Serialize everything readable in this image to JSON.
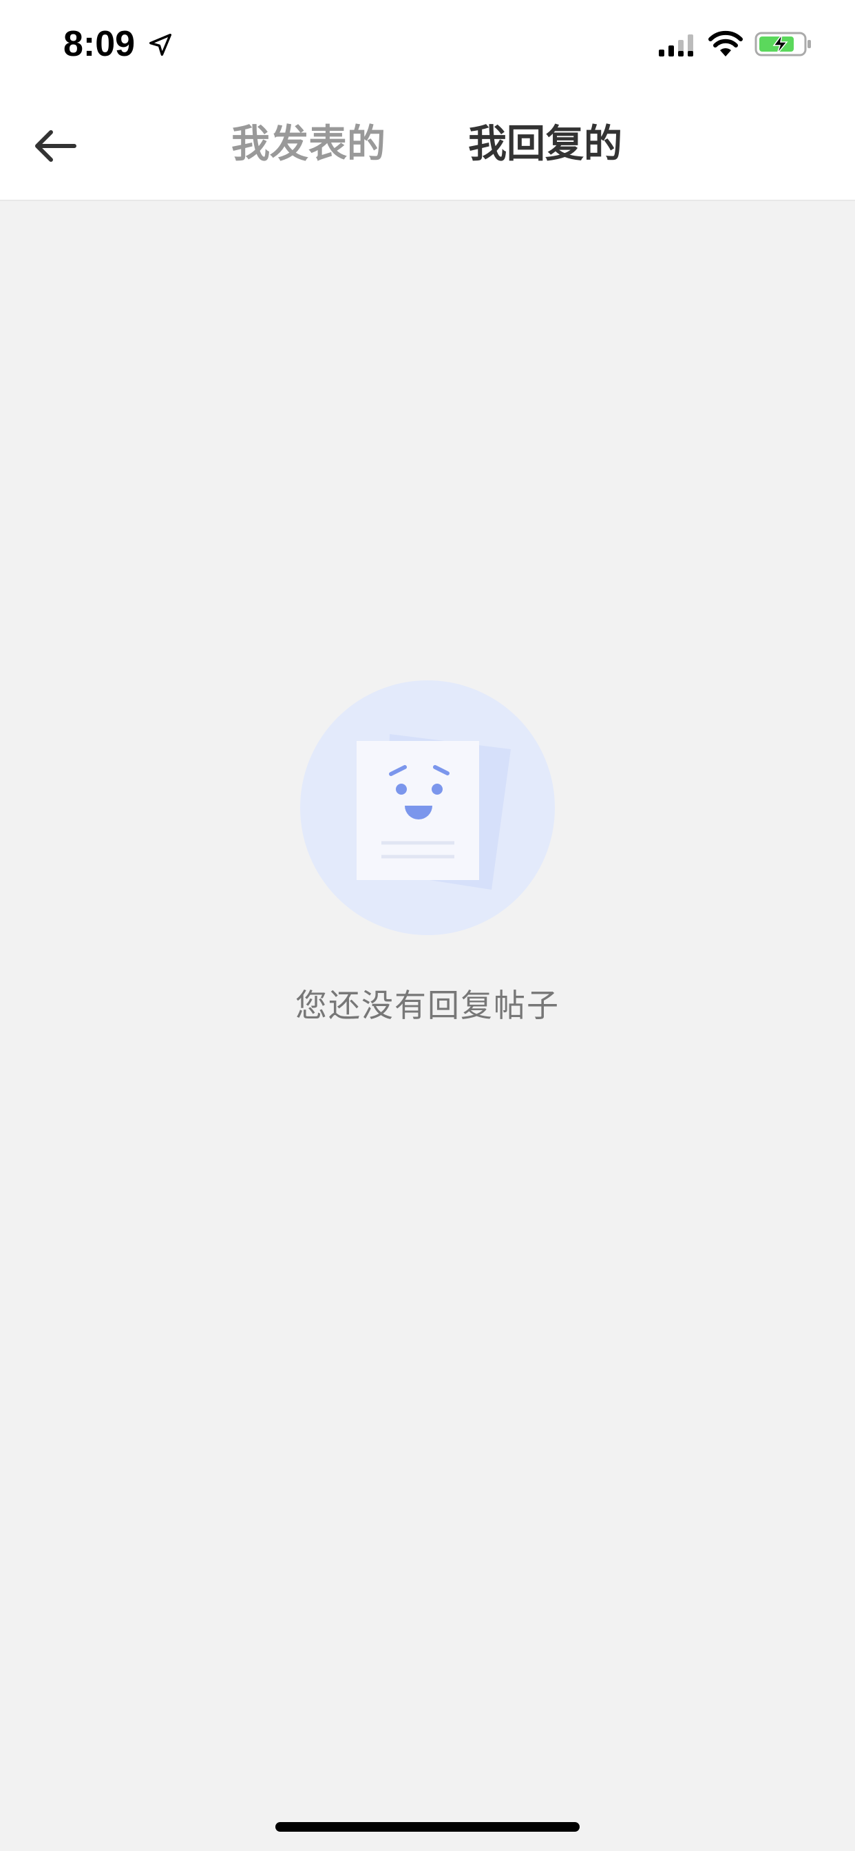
{
  "status_bar": {
    "time": "8:09"
  },
  "nav": {
    "tabs": [
      {
        "label": "我发表的",
        "active": false
      },
      {
        "label": "我回复的",
        "active": true
      }
    ]
  },
  "empty_state": {
    "message": "您还没有回复帖子"
  },
  "colors": {
    "background": "#f2f2f2",
    "active_tab": "#333333",
    "inactive_tab": "#999999",
    "illustration_circle": "#e3eafb",
    "illustration_accent": "#7b96ec",
    "battery_green": "#5bd85c"
  },
  "icons": [
    "back-arrow-icon",
    "location-icon",
    "signal-icon",
    "wifi-icon",
    "battery-icon",
    "empty-document-face-icon"
  ]
}
